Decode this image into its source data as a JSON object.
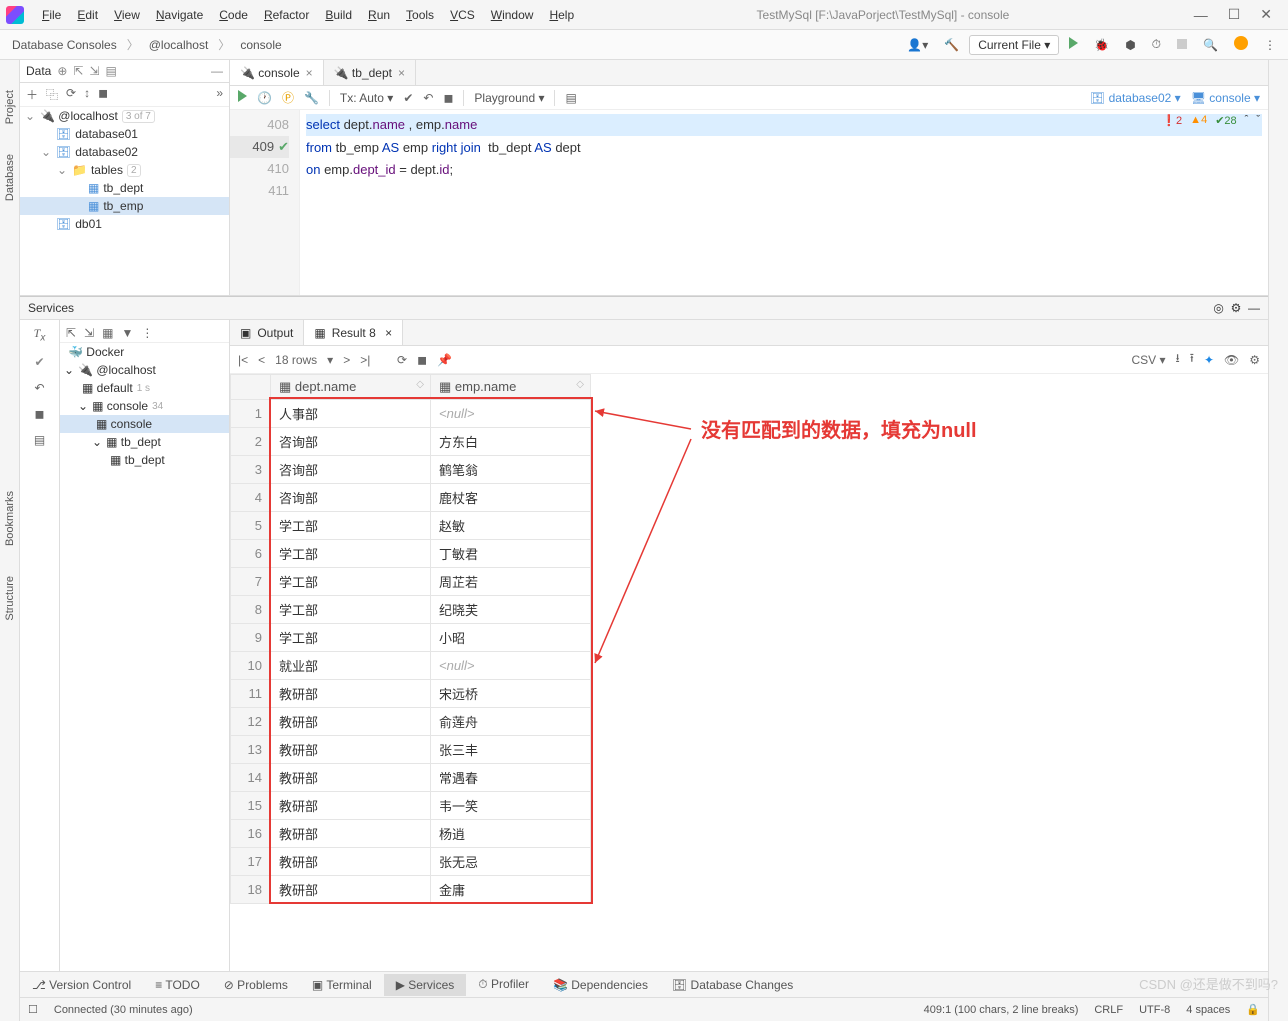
{
  "window": {
    "title": "TestMySql [F:\\JavaPorject\\TestMySql] - console"
  },
  "menu": [
    "File",
    "Edit",
    "View",
    "Navigate",
    "Code",
    "Refactor",
    "Build",
    "Run",
    "Tools",
    "VCS",
    "Window",
    "Help"
  ],
  "breadcrumb": [
    "Database Consoles",
    "@localhost",
    "console"
  ],
  "run_config": "Current File",
  "db_panel": {
    "title": "Data",
    "root": {
      "label": "@localhost",
      "count": "3 of 7"
    },
    "children": [
      {
        "label": "database01",
        "type": "db",
        "expanded": false
      },
      {
        "label": "database02",
        "type": "db",
        "expanded": true,
        "children": [
          {
            "label": "tables",
            "type": "folder",
            "count": "2",
            "expanded": true,
            "children": [
              {
                "label": "tb_dept",
                "type": "table"
              },
              {
                "label": "tb_emp",
                "type": "table",
                "selected": true
              }
            ]
          }
        ]
      },
      {
        "label": "db01",
        "type": "db",
        "expanded": false
      }
    ]
  },
  "editor": {
    "tabs": [
      {
        "label": "console",
        "active": true,
        "closable": true
      },
      {
        "label": "tb_dept",
        "active": false,
        "closable": true
      }
    ],
    "tx_mode": "Tx: Auto",
    "playground": "Playground",
    "datasource": "database02",
    "console_sel": "console",
    "lines": {
      "l408": "",
      "l409": "select dept.name , emp.name",
      "l410": "from tb_emp AS emp right join  tb_dept AS dept",
      "l411": "on emp.dept_id = dept.id;"
    },
    "gutter": [
      "408",
      "409",
      "410",
      "411"
    ],
    "status": {
      "err": "2",
      "warn": "4",
      "ok": "28"
    }
  },
  "services": {
    "title": "Services",
    "tree": [
      {
        "label": "Docker",
        "type": "docker"
      },
      {
        "label": "@localhost",
        "type": "ds",
        "expanded": true,
        "children": [
          {
            "label": "default",
            "count": "1 s"
          },
          {
            "label": "console",
            "count": "34",
            "expanded": true,
            "children": [
              {
                "label": "console",
                "selected": true
              },
              {
                "label": "tb_dept",
                "expanded": true,
                "children": [
                  {
                    "label": "tb_dept"
                  }
                ]
              }
            ]
          }
        ]
      }
    ],
    "output_tab": "Output",
    "result_tab": "Result 8",
    "rows_label": "18 rows",
    "export_fmt": "CSV",
    "columns": [
      "dept.name",
      "emp.name"
    ],
    "rows": [
      [
        "人事部",
        null
      ],
      [
        "咨询部",
        "方东白"
      ],
      [
        "咨询部",
        "鹤笔翁"
      ],
      [
        "咨询部",
        "鹿杖客"
      ],
      [
        "学工部",
        "赵敏"
      ],
      [
        "学工部",
        "丁敏君"
      ],
      [
        "学工部",
        "周芷若"
      ],
      [
        "学工部",
        "纪晓芙"
      ],
      [
        "学工部",
        "小昭"
      ],
      [
        "就业部",
        null
      ],
      [
        "教研部",
        "宋远桥"
      ],
      [
        "教研部",
        "俞莲舟"
      ],
      [
        "教研部",
        "张三丰"
      ],
      [
        "教研部",
        "常遇春"
      ],
      [
        "教研部",
        "韦一笑"
      ],
      [
        "教研部",
        "杨逍"
      ],
      [
        "教研部",
        "张无忌"
      ],
      [
        "教研部",
        "金庸"
      ]
    ]
  },
  "annotation": "没有匹配到的数据，填充为null",
  "bottom_tabs": [
    "Version Control",
    "TODO",
    "Problems",
    "Terminal",
    "Services",
    "Profiler",
    "Dependencies",
    "Database Changes"
  ],
  "bottom_active": "Services",
  "status_bar": {
    "left": "Connected (30 minutes ago)",
    "caret": "409:1 (100 chars, 2 line breaks)",
    "eol": "CRLF",
    "enc": "UTF-8",
    "indent": "4 spaces"
  },
  "sidebar_left": [
    "Project",
    "Database",
    "Bookmarks",
    "Structure"
  ],
  "watermark": "CSDN @还是做不到吗?"
}
